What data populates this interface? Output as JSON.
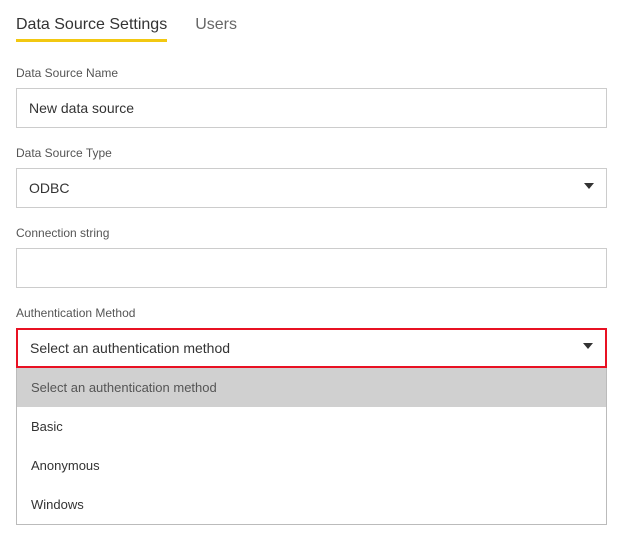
{
  "tabs": {
    "settings": "Data Source Settings",
    "users": "Users"
  },
  "fields": {
    "name_label": "Data Source Name",
    "name_value": "New data source",
    "type_label": "Data Source Type",
    "type_value": "ODBC",
    "conn_label": "Connection string",
    "conn_value": "",
    "auth_label": "Authentication Method",
    "auth_value": "Select an authentication method"
  },
  "auth_options": {
    "placeholder": "Select an authentication method",
    "basic": "Basic",
    "anonymous": "Anonymous",
    "windows": "Windows"
  }
}
